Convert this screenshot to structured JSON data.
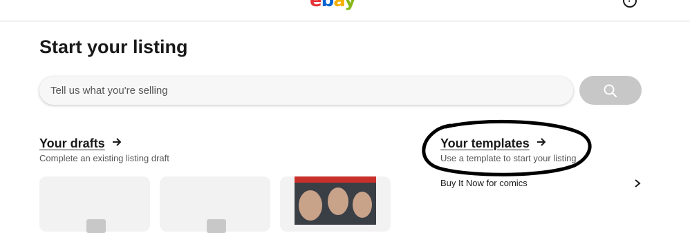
{
  "header": {
    "logo_letters": [
      "e",
      "b",
      "a",
      "y"
    ]
  },
  "page": {
    "title": "Start your listing"
  },
  "search": {
    "placeholder": "Tell us what you're selling",
    "button_color": "#c7c7c7"
  },
  "drafts": {
    "title": "Your drafts",
    "subtitle": "Complete an existing listing draft"
  },
  "templates": {
    "title": "Your templates",
    "subtitle": "Use a template to start your listing",
    "items": [
      {
        "label": "Buy It Now for comics"
      }
    ]
  },
  "colors": {
    "logo_e": "#e53238",
    "logo_b": "#0064d2",
    "logo_a": "#f5af02",
    "logo_y": "#86b817",
    "annotation": "#000000"
  },
  "icons": [
    "help-icon",
    "search-icon",
    "arrow-right-icon",
    "chevron-right-icon"
  ]
}
